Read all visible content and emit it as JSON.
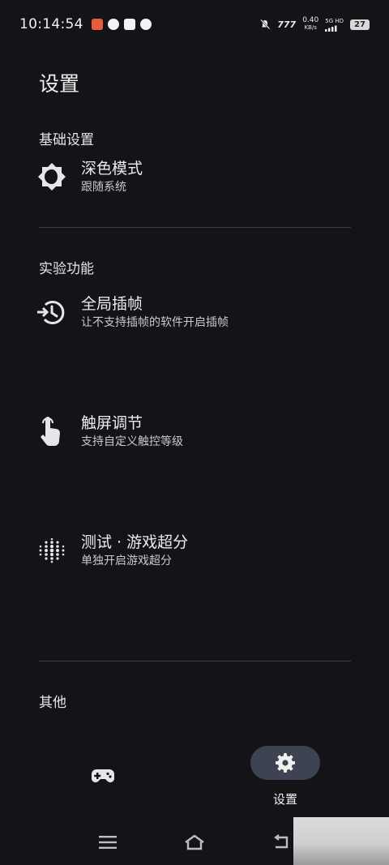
{
  "status_bar": {
    "time": "10:14:54",
    "net_speed_value": "0.40",
    "net_speed_unit": "KB/s",
    "network": "5G HD",
    "signal_text": "777",
    "battery": "27"
  },
  "page": {
    "title": "设置"
  },
  "sections": {
    "basic": {
      "header": "基础设置",
      "dark_mode": {
        "title": "深色模式",
        "subtitle": "跟随系统",
        "icon": "brightness-auto-icon"
      }
    },
    "experimental": {
      "header": "实验功能",
      "frame_interp": {
        "title": "全局插帧",
        "subtitle": "让不支持插帧的软件开启插帧",
        "icon": "history-rotate-icon"
      },
      "touch": {
        "title": "触屏调节",
        "subtitle": "支持自定义触控等级",
        "icon": "touch-hand-icon"
      },
      "super_res": {
        "title": "测试 · 游戏超分",
        "subtitle": "单独开启游戏超分",
        "icon": "dot-grid-icon"
      }
    },
    "other": {
      "header": "其他"
    }
  },
  "bottom_nav": {
    "games_icon": "gamepad-icon",
    "settings_icon": "gear-icon",
    "settings_label": "设置"
  },
  "colors": {
    "background": "#131318",
    "nav_pill": "#3e4354",
    "divider": "#3c3c44"
  }
}
